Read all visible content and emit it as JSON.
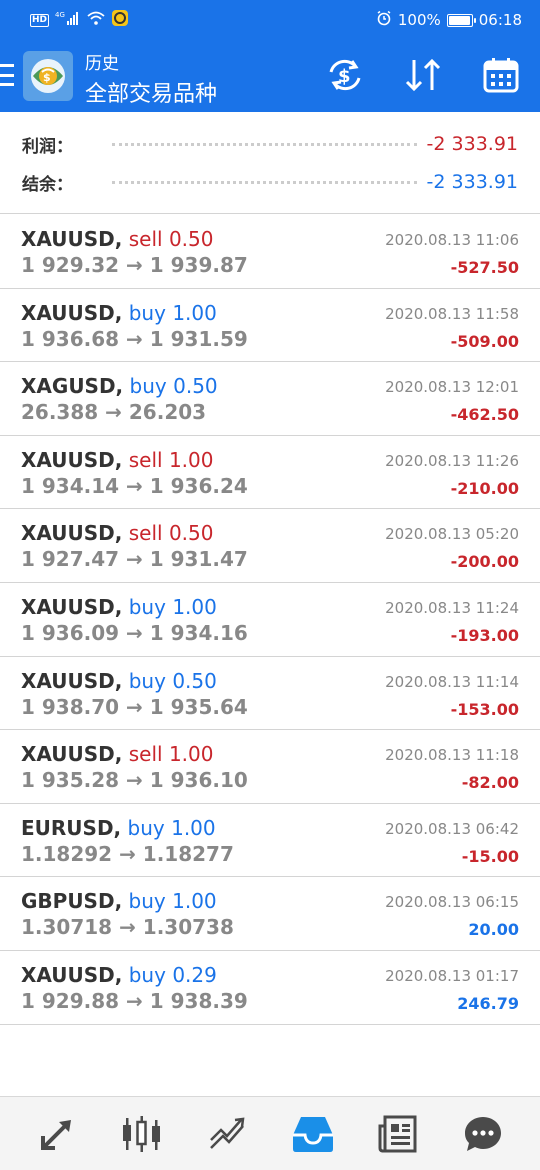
{
  "status_bar": {
    "left_badge": "HD",
    "network": "4G",
    "battery_text": "100%",
    "battery_level": 1.0,
    "time": "06:18"
  },
  "appbar": {
    "title": "历史",
    "subtitle": "全部交易品种",
    "actions": [
      "currency-exchange-icon",
      "sort-icon",
      "calendar-icon"
    ]
  },
  "summary": {
    "profit_label": "利润：",
    "profit_value": "-2 333.91",
    "balance_label": "结余：",
    "balance_value": "-2 333.91"
  },
  "trades": [
    {
      "symbol": "XAUUSD,",
      "side": "sell",
      "volume": "0.50",
      "open": "1 929.32",
      "close": "1 939.87",
      "time": "2020.08.13 11:06",
      "pl": "-527.50"
    },
    {
      "symbol": "XAUUSD,",
      "side": "buy",
      "volume": "1.00",
      "open": "1 936.68",
      "close": "1 931.59",
      "time": "2020.08.13 11:58",
      "pl": "-509.00"
    },
    {
      "symbol": "XAGUSD,",
      "side": "buy",
      "volume": "0.50",
      "open": "26.388",
      "close": "26.203",
      "time": "2020.08.13 12:01",
      "pl": "-462.50"
    },
    {
      "symbol": "XAUUSD,",
      "side": "sell",
      "volume": "1.00",
      "open": "1 934.14",
      "close": "1 936.24",
      "time": "2020.08.13 11:26",
      "pl": "-210.00"
    },
    {
      "symbol": "XAUUSD,",
      "side": "sell",
      "volume": "0.50",
      "open": "1 927.47",
      "close": "1 931.47",
      "time": "2020.08.13 05:20",
      "pl": "-200.00"
    },
    {
      "symbol": "XAUUSD,",
      "side": "buy",
      "volume": "1.00",
      "open": "1 936.09",
      "close": "1 934.16",
      "time": "2020.08.13 11:24",
      "pl": "-193.00"
    },
    {
      "symbol": "XAUUSD,",
      "side": "buy",
      "volume": "0.50",
      "open": "1 938.70",
      "close": "1 935.64",
      "time": "2020.08.13 11:14",
      "pl": "-153.00"
    },
    {
      "symbol": "XAUUSD,",
      "side": "sell",
      "volume": "1.00",
      "open": "1 935.28",
      "close": "1 936.10",
      "time": "2020.08.13 11:18",
      "pl": "-82.00"
    },
    {
      "symbol": "EURUSD,",
      "side": "buy",
      "volume": "1.00",
      "open": "1.18292",
      "close": "1.18277",
      "time": "2020.08.13 06:42",
      "pl": "-15.00"
    },
    {
      "symbol": "GBPUSD,",
      "side": "buy",
      "volume": "1.00",
      "open": "1.30718",
      "close": "1.30738",
      "time": "2020.08.13 06:15",
      "pl": "20.00"
    },
    {
      "symbol": "XAUUSD,",
      "side": "buy",
      "volume": "0.29",
      "open": "1 929.88",
      "close": "1 938.39",
      "time": "2020.08.13 01:17",
      "pl": "246.79"
    }
  ],
  "arrow": "→",
  "bottom_nav": [
    "quotes-icon",
    "chart-icon",
    "trade-icon",
    "history-icon",
    "news-icon",
    "chat-icon"
  ],
  "colors": {
    "accent": "#1a73e8",
    "negative": "#c8262c",
    "positive": "#1a73e8",
    "active_nav": "#1a8fe8",
    "inactive_nav": "#4a4a4a"
  }
}
